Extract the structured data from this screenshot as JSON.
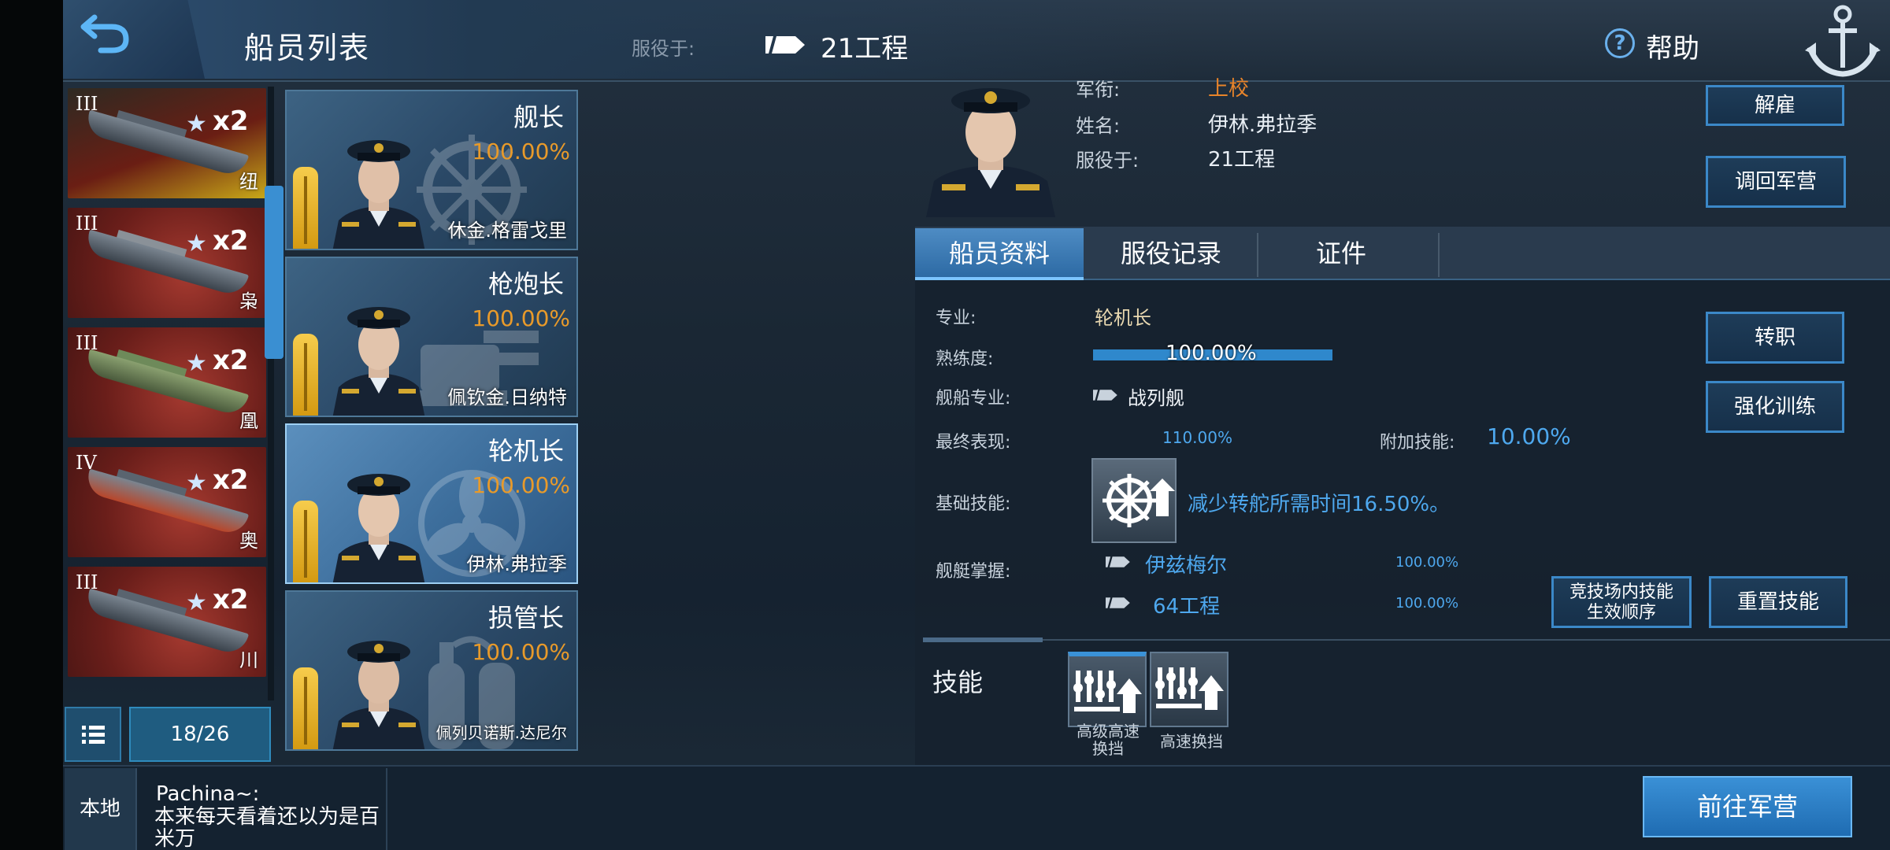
{
  "header": {
    "title": "船员列表",
    "service_label": "服役于:",
    "service_ship": "21工程",
    "help_label": "帮助"
  },
  "ship_list": {
    "items": [
      {
        "tier": "III",
        "count": "x2",
        "name": "纽"
      },
      {
        "tier": "III",
        "count": "x2",
        "name": "枭"
      },
      {
        "tier": "III",
        "count": "x2",
        "name": "凰"
      },
      {
        "tier": "IV",
        "count": "x2",
        "name": "奥"
      },
      {
        "tier": "III",
        "count": "x2",
        "name": "川"
      }
    ],
    "counter": "18/26"
  },
  "crew": [
    {
      "role": "舰长",
      "percent": "100.00%",
      "name": "休金.格雷戈里"
    },
    {
      "role": "枪炮长",
      "percent": "100.00%",
      "name": "佩钦金.日纳特"
    },
    {
      "role": "轮机长",
      "percent": "100.00%",
      "name": "伊林.弗拉季"
    },
    {
      "role": "损管长",
      "percent": "100.00%",
      "name": "佩列贝诺斯.达尼尔"
    }
  ],
  "profile": {
    "rank_label": "军衔:",
    "rank_value": "上校",
    "name_label": "姓名:",
    "name_value": "伊林.弗拉季",
    "service_label": "服役于:",
    "service_value": "21工程",
    "dismiss_button": "解雇",
    "recall_button": "调回军营"
  },
  "tabs": [
    {
      "label": "船员资料"
    },
    {
      "label": "服役记录"
    },
    {
      "label": "证件"
    }
  ],
  "details": {
    "specialty_label": "专业:",
    "specialty_value": "轮机长",
    "proficiency_label": "熟练度:",
    "proficiency_value": "100.00%",
    "ship_spec_label": "舰船专业:",
    "ship_spec_value": "战列舰",
    "final_perf_label": "最终表现:",
    "final_perf_value": "110.00%",
    "extra_skill_label": "附加技能:",
    "extra_skill_value": "10.00%",
    "base_skill_label": "基础技能:",
    "base_skill_desc": "减少转舵所需时间16.50%。",
    "mastery_label": "舰艇掌握:",
    "mastery": [
      {
        "ship": "伊兹梅尔",
        "value": "100.00%"
      },
      {
        "ship": "64工程",
        "value": "100.00%"
      }
    ],
    "transfer_button": "转职",
    "training_button": "强化训练",
    "arena_order_button_line1": "竞技场内技能",
    "arena_order_button_line2": "生效顺序",
    "reset_button": "重置技能",
    "skills_title": "技能",
    "skills": [
      {
        "line1": "高级高速",
        "line2": "换挡"
      },
      {
        "line1": "高速换挡",
        "line2": ""
      }
    ]
  },
  "bottom": {
    "local_tab": "本地",
    "chat_user": "Pachina~:",
    "chat_message": "本来每天看着还以为是百米万",
    "go_button": "前往军营"
  },
  "colors": {
    "accent_blue": "#3a8fd2",
    "rank_orange": "#e8842a",
    "percent_orange": "#e89a2a"
  }
}
